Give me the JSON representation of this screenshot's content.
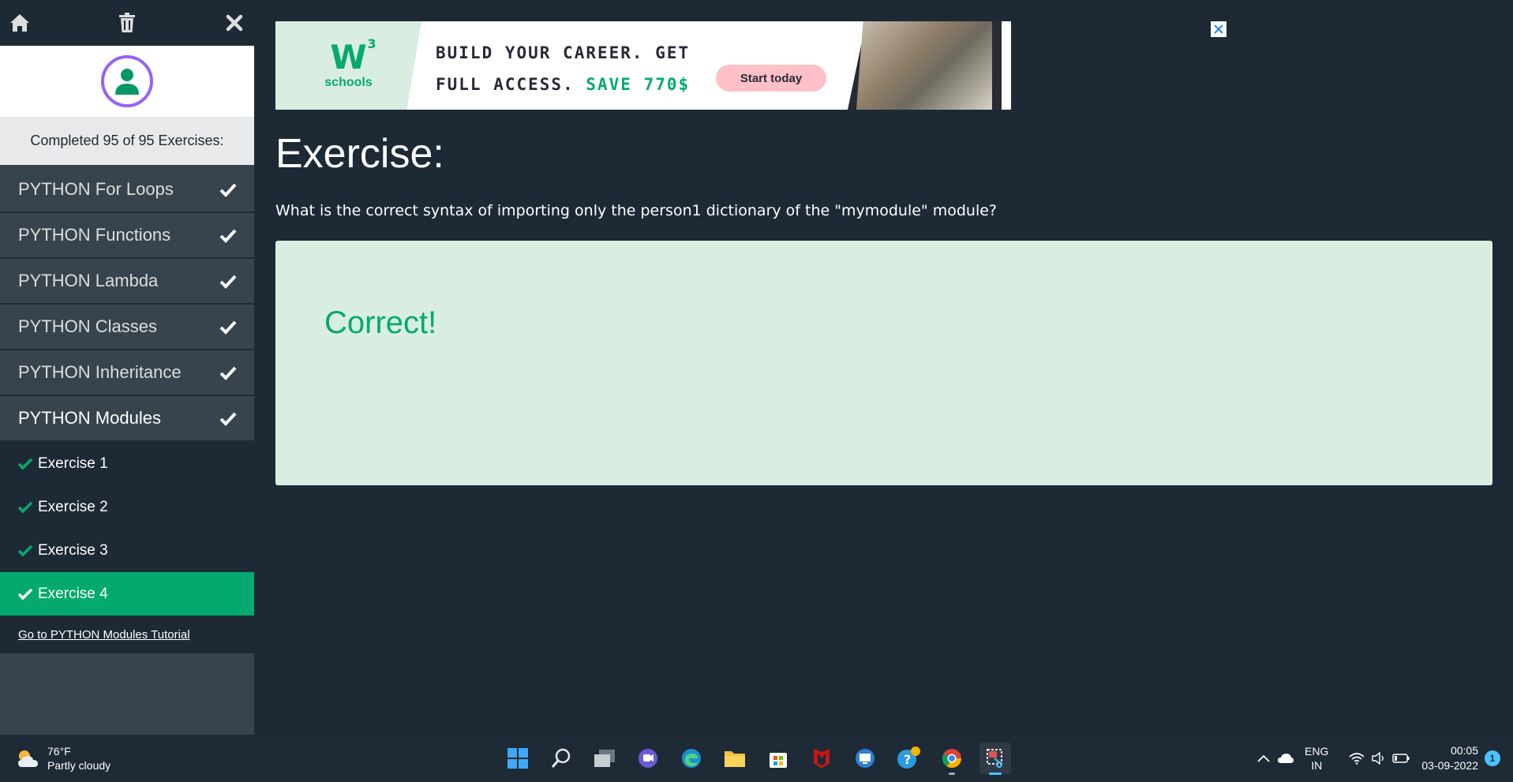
{
  "sidebar": {
    "progress_text": "Completed 95 of 95 Exercises:",
    "categories": [
      {
        "label": "PYTHON For Loops"
      },
      {
        "label": "PYTHON Functions"
      },
      {
        "label": "PYTHON Lambda"
      },
      {
        "label": "PYTHON Classes"
      },
      {
        "label": "PYTHON Inheritance"
      },
      {
        "label": "PYTHON Modules"
      }
    ],
    "exercises": [
      {
        "label": "Exercise 1"
      },
      {
        "label": "Exercise 2"
      },
      {
        "label": "Exercise 3"
      },
      {
        "label": "Exercise 4"
      }
    ],
    "tutorial_link": "Go to PYTHON Modules Tutorial"
  },
  "ad": {
    "logo_text": "W",
    "logo_sup": "3",
    "logo_sub": "schools",
    "line1": "BUILD YOUR CAREER. GET",
    "line2_prefix": "FULL ACCESS. ",
    "line2_highlight": "SAVE 770$",
    "cta": "Start today"
  },
  "main": {
    "title": "Exercise:",
    "question": "What is the correct syntax of importing only the person1 dictionary of the \"mymodule\" module?",
    "result": "Correct!"
  },
  "taskbar": {
    "weather_temp": "76°F",
    "weather_desc": "Partly cloudy",
    "lang_line1": "ENG",
    "lang_line2": "IN",
    "time": "00:05",
    "date": "03-09-2022",
    "notification_count": "1"
  },
  "colors": {
    "accent": "#04aa6d",
    "sidebar_bg": "#38444d",
    "page_bg": "#1d2a35",
    "result_bg": "#d9eee1",
    "avatar_ring": "#9763f6"
  }
}
